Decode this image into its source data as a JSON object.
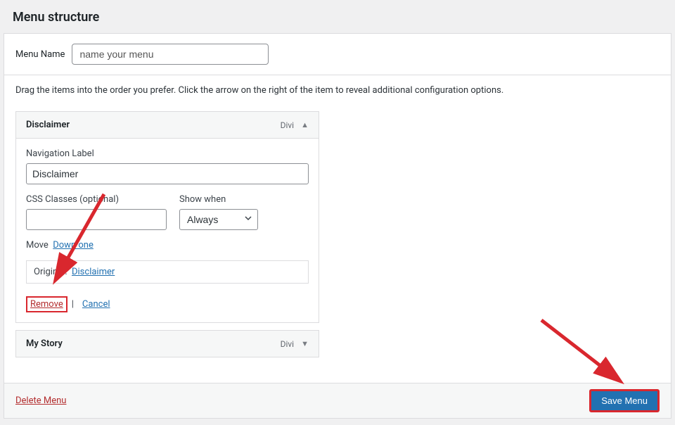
{
  "header": {
    "title": "Menu structure"
  },
  "menu_name": {
    "label": "Menu Name",
    "placeholder": "name your menu",
    "value": "name your menu"
  },
  "instructions": "Drag the items into the order you prefer. Click the arrow on the right of the item to reveal additional configuration options.",
  "items": [
    {
      "title": "Disclaimer",
      "type": "Divi",
      "expanded": true,
      "navigation_label_label": "Navigation Label",
      "navigation_label_value": "Disclaimer",
      "css_classes_label": "CSS Classes (optional)",
      "css_classes_value": "",
      "show_when_label": "Show when",
      "show_when_value": "Always",
      "move_label": "Move",
      "move_down_label": "Down one",
      "original_label": "Original:",
      "original_link": "Disclaimer",
      "remove_label": "Remove",
      "cancel_label": "Cancel"
    },
    {
      "title": "My Story",
      "type": "Divi",
      "expanded": false
    }
  ],
  "footer": {
    "delete_label": "Delete Menu",
    "save_label": "Save Menu"
  },
  "annotations": {
    "arrow_color": "#d9272e"
  }
}
